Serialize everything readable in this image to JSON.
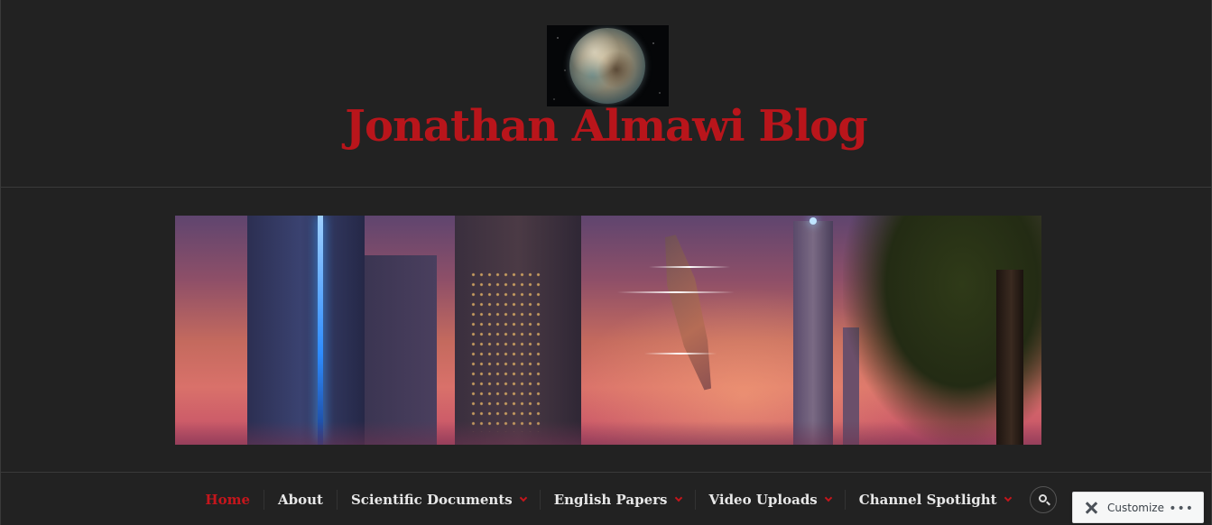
{
  "site": {
    "title": "Jonathan Almawi Blog",
    "logo_icon": "planet-logo",
    "accent_color": "#c4161c",
    "background_color": "#222222"
  },
  "banner": {
    "icon": "sci-fi-city-banner-image"
  },
  "nav": {
    "items": [
      {
        "label": "Home",
        "active": true,
        "has_dropdown": false
      },
      {
        "label": "About",
        "active": false,
        "has_dropdown": false
      },
      {
        "label": "Scientific Documents",
        "active": false,
        "has_dropdown": true
      },
      {
        "label": "English Papers",
        "active": false,
        "has_dropdown": true
      },
      {
        "label": "Video Uploads",
        "active": false,
        "has_dropdown": true
      },
      {
        "label": "Channel Spotlight",
        "active": false,
        "has_dropdown": true
      }
    ],
    "search_icon": "search-icon"
  },
  "customize": {
    "label": "Customize",
    "icon": "wrench-screwdriver-icon",
    "more_icon": "ellipsis-icon",
    "more_glyph": "•••"
  }
}
